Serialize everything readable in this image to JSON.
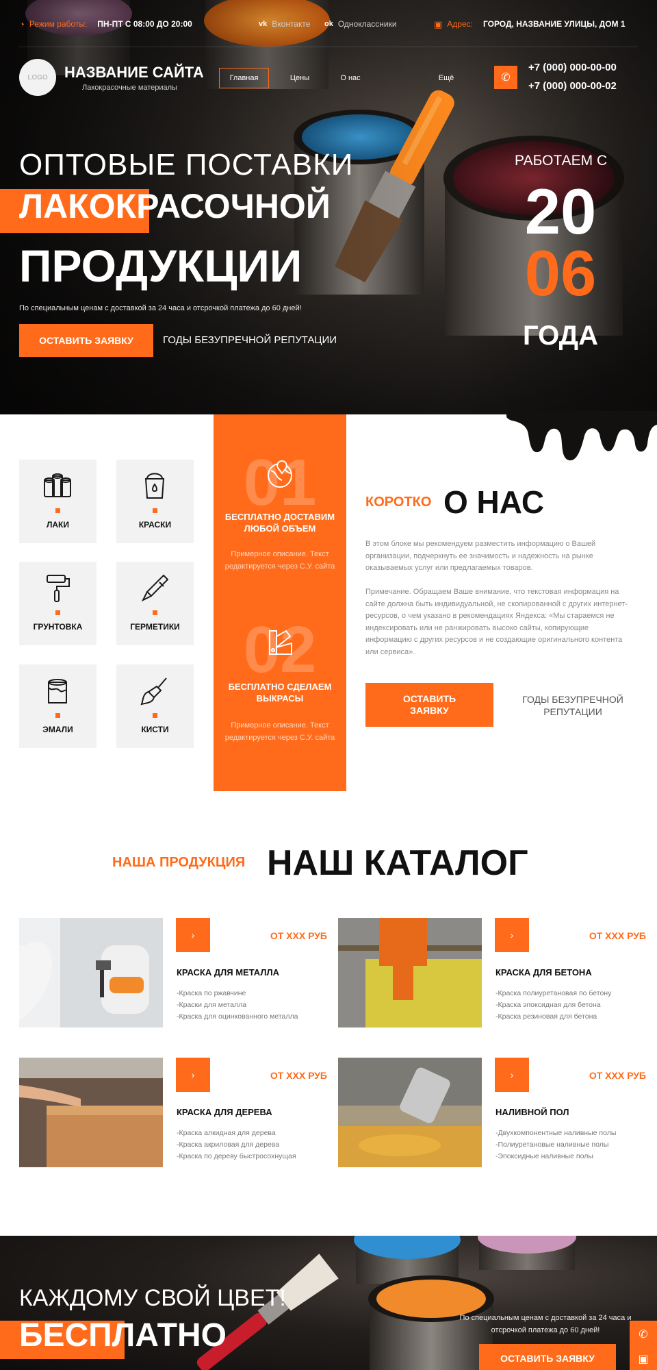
{
  "topbar": {
    "hours_label": "Режим работы:",
    "hours_value": "ПН-ПТ С 08:00 ДО 20:00",
    "vk": "Вконтакте",
    "ok": "Одноклассники",
    "address_label": "Адрес:",
    "address_value": "ГОРОД, НАЗВАНИЕ УЛИЦЫ, ДОМ 1"
  },
  "header": {
    "logo": "LOGO",
    "site_name": "НАЗВАНИЕ САЙТА",
    "site_tagline": "Лакокрасочные материалы",
    "nav": [
      "Главная",
      "Цены",
      "О нас",
      "Ещё"
    ],
    "phones": [
      "+7 (000) 000-00-00",
      "+7 (000) 000-00-02"
    ]
  },
  "hero": {
    "line1": "ОПТОВЫЕ ПОСТАВКИ",
    "line2": "ЛАКОКРАСОЧНОЙ",
    "line3": "ПРОДУКЦИИ",
    "subtitle": "По специальным ценам с доставкой за 24 часа и отсрочкой платежа до 60 дней!",
    "cta": "ОСТАВИТЬ ЗАЯВКУ",
    "reputation": "ГОДЫ БЕЗУПРЕЧНОЙ РЕПУТАЦИИ",
    "since_label": "РАБОТАЕМ С",
    "since_year_a": "20",
    "since_year_b": "06",
    "since_suffix": "ГОДА"
  },
  "categories": [
    "ЛАКИ",
    "КРАСКИ",
    "ГРУНТОВКА",
    "ГЕРМЕТИКИ",
    "ЭМАЛИ",
    "КИСТИ"
  ],
  "features": [
    {
      "num": "01",
      "title": "БЕСПЛАТНО ДОСТАВИМ ЛЮБОЙ ОБЪЕМ",
      "desc": "Примерное описание. Текст редактируется через С.У. сайта"
    },
    {
      "num": "02",
      "title": "БЕСПЛАТНО СДЕЛАЕМ ВЫКРАСЫ",
      "desc": "Примерное описание. Текст редактируется через С.У. сайта"
    }
  ],
  "about": {
    "kicker": "КОРОТКО",
    "title": "О НАС",
    "p1": "В этом блоке мы рекомендуем разместить информацию о Вашей организации, подчеркнуть ее значимость и надежность на рынке оказываемых услуг или предлагаемых товаров.",
    "p2": "Примечание. Обращаем Ваше внимание, что текстовая информация на сайте должна быть индивидуальной, не скопированной с других интернет-ресурсов, о чем указано в рекомендациях Яндекса: «Мы стараемся не индексировать или не ранжировать высоко сайты, копирующие информацию с других ресурсов и не создающие оригинального контента или сервиса».",
    "cta": "ОСТАВИТЬ ЗАЯВКУ",
    "reputation": "ГОДЫ БЕЗУПРЕЧНОЙ РЕПУТАЦИИ"
  },
  "catalog": {
    "kicker": "НАША ПРОДУКЦИЯ",
    "title": "НАШ КАТАЛОГ",
    "arrow": "›",
    "items": [
      {
        "price": "ОТ ХХХ РУБ",
        "name": "КРАСКА ДЛЯ МЕТАЛЛА",
        "lines": [
          "-Краска по ржавчине",
          "-Краски для металла",
          "-Краска для оцинкованного металла"
        ]
      },
      {
        "price": "ОТ ХХХ РУБ",
        "name": "КРАСКА ДЛЯ БЕТОНА",
        "lines": [
          "-Краска полиуретановая по бетону",
          "-Краска эпоксидная для бетона",
          "-Краска резиновая для бетона"
        ]
      },
      {
        "price": "ОТ ХХХ РУБ",
        "name": "КРАСКА ДЛЯ ДЕРЕВА",
        "lines": [
          "-Краска алкидная для дерева",
          "-Краска акриловая для дерева",
          "-Краска по дереву быстросохнущая"
        ]
      },
      {
        "price": "ОТ ХХХ РУБ",
        "name": "НАЛИВНОЙ ПОЛ",
        "lines": [
          "-Двухкомпонентные наливные полы",
          "-Полиуретановые наливные полы",
          "-Эпоксидные наливные полы"
        ]
      }
    ]
  },
  "banner": {
    "line1": "КАЖДОМУ СВОЙ ЦВЕТ!",
    "line2": "БЕСПЛАТНО",
    "subtitle": "По специальным ценам с доставкой за 24 часа и отсрочкой платежа до 60 дней!",
    "cta": "ОСТАВИТЬ ЗАЯВКУ"
  },
  "icons": [
    "clock-icon",
    "vk-icon",
    "ok-icon",
    "map-icon",
    "phone-icon",
    "globe-pin-icon",
    "palette-swatch-icon",
    "cans-icon",
    "bucket-icon",
    "roller-icon",
    "sealant-gun-icon",
    "enamel-can-icon",
    "brush-icon"
  ],
  "colors": {
    "accent": "#ff6b1a",
    "dark": "#151312",
    "card": "#f2f2f2"
  }
}
